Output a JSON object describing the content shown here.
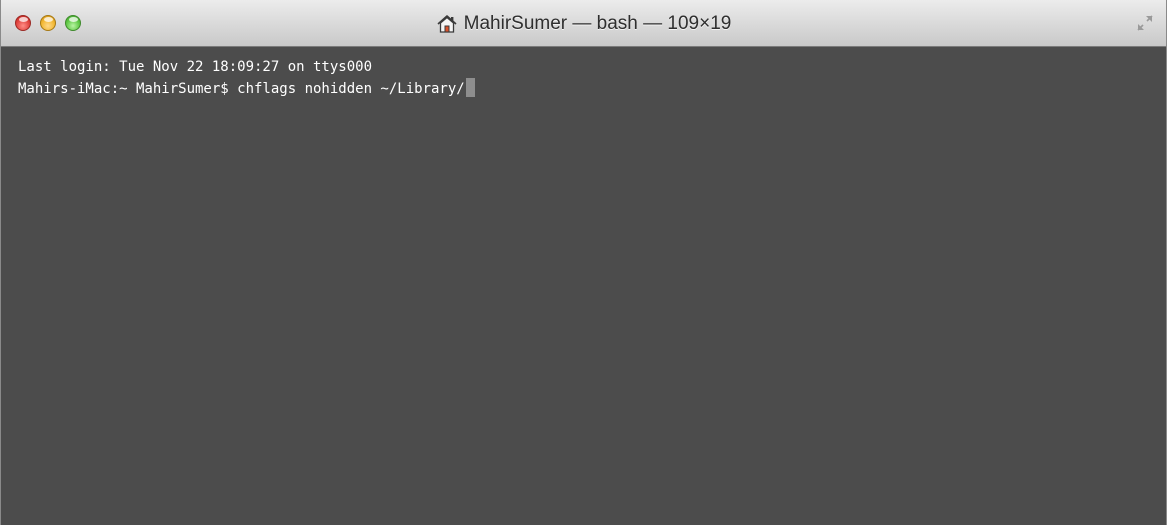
{
  "window": {
    "title": "MahirSumer — bash — 109×19",
    "title_icon": "home-icon",
    "fullscreen_icon": "fullscreen-arrows-icon"
  },
  "colors": {
    "terminal_background": "#4c4c4c",
    "terminal_text": "#ffffff",
    "cursor": "#8e8e8e",
    "close": "#e0443e",
    "minimize": "#f2b731",
    "zoom": "#5fc845"
  },
  "terminal": {
    "lines": [
      "Last login: Tue Nov 22 18:09:27 on ttys000",
      "Mahirs-iMac:~ MahirSumer$ chflags nohidden ~/Library/"
    ]
  }
}
